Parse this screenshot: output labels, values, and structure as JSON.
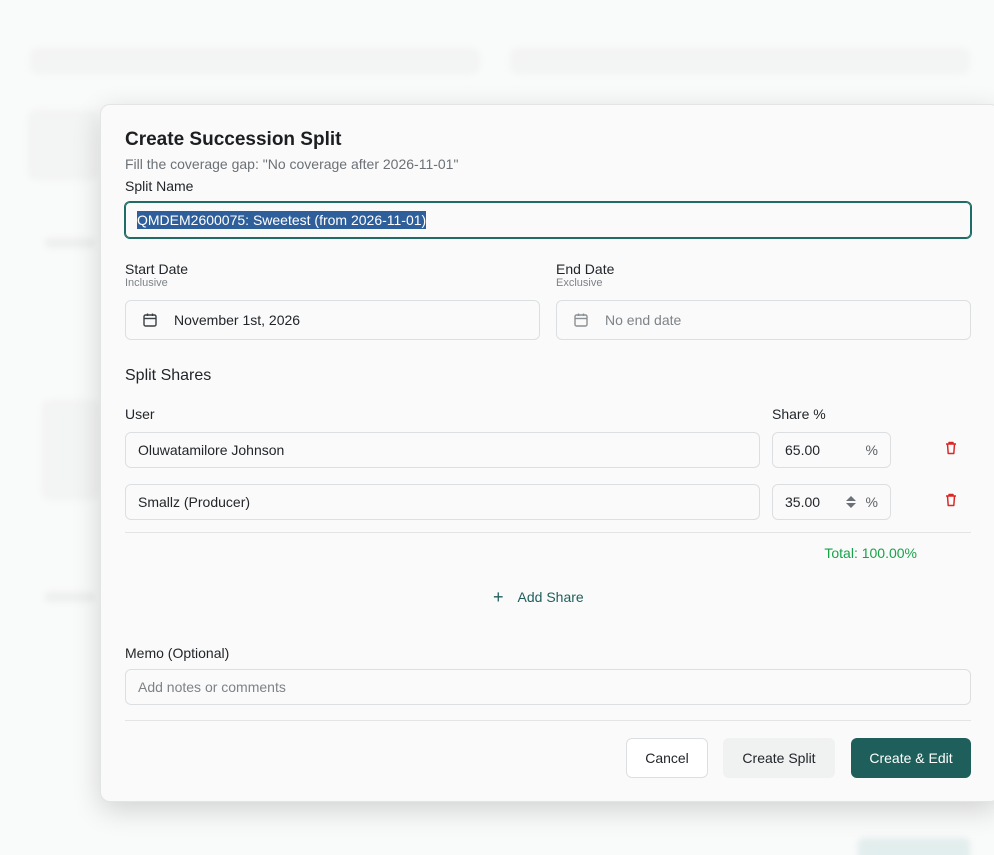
{
  "dialog": {
    "title": "Create Succession Split",
    "subtitle": "Fill the coverage gap: \"No coverage after 2026-11-01\"",
    "split_name": {
      "label": "Split Name",
      "value": "QMDEM2600075: Sweetest (from 2026-11-01)"
    },
    "start_date": {
      "label": "Start Date",
      "hint": "Inclusive",
      "value": "November 1st, 2026"
    },
    "end_date": {
      "label": "End Date",
      "hint": "Exclusive",
      "placeholder": "No end date"
    },
    "shares_section": {
      "title": "Split Shares",
      "user_header": "User",
      "share_header": "Share %",
      "pct_symbol": "%",
      "rows": [
        {
          "user": "Oluwatamilore Johnson",
          "share": "65.00"
        },
        {
          "user": "Smallz (Producer)",
          "share": "35.00"
        }
      ],
      "total": "Total: 100.00%",
      "add_label": "Add Share"
    },
    "memo": {
      "label": "Memo (Optional)",
      "placeholder": "Add notes or comments"
    },
    "buttons": {
      "cancel": "Cancel",
      "create": "Create Split",
      "create_edit": "Create & Edit"
    }
  },
  "colors": {
    "accent": "#1f5f5b",
    "total": "#17a34a",
    "delete": "#dc2626"
  },
  "icons": {
    "calendar": "calendar-icon",
    "trash": "trash-icon",
    "plus": "plus-icon"
  }
}
